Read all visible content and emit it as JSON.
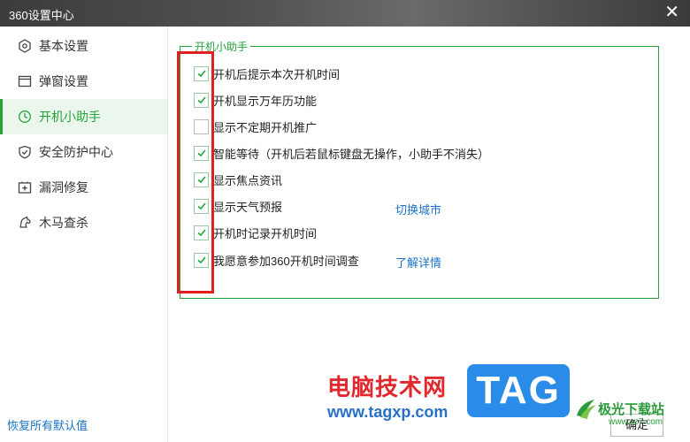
{
  "window": {
    "title": "360设置中心",
    "close_glyph": "✕"
  },
  "sidebar": {
    "items": [
      {
        "label": "基本设置",
        "icon": "hexagon-gear-icon"
      },
      {
        "label": "弹窗设置",
        "icon": "window-icon"
      },
      {
        "label": "开机小助手",
        "icon": "clock-icon",
        "active": true
      },
      {
        "label": "安全防护中心",
        "icon": "shield-icon"
      },
      {
        "label": "漏洞修复",
        "icon": "patch-plus-icon"
      },
      {
        "label": "木马查杀",
        "icon": "horse-icon"
      }
    ],
    "restore_label": "恢复所有默认值"
  },
  "main": {
    "group_title": "开机小助手",
    "options": [
      {
        "label": "开机后提示本次开机时间",
        "checked": true
      },
      {
        "label": "开机显示万年历功能",
        "checked": true
      },
      {
        "label": "显示不定期开机推广",
        "checked": false
      },
      {
        "label": "智能等待（开机后若鼠标键盘无操作，小助手不消失）",
        "checked": true
      },
      {
        "label": "显示焦点资讯",
        "checked": true
      },
      {
        "label": "显示天气预报",
        "checked": true
      },
      {
        "label": "开机时记录开机时间",
        "checked": true
      },
      {
        "label": "我愿意参加360开机时间调查",
        "checked": true
      }
    ],
    "switch_city_label": "切换城市",
    "learn_more_label": "了解详情"
  },
  "footer": {
    "ok_label": "确定"
  },
  "watermark": {
    "cn_text": "电脑技术网",
    "url_text": "www.tagxp.com",
    "tag_text": "TAG",
    "logo_text": "极光下载站",
    "logo_url": "www.xz7.com"
  },
  "colors": {
    "accent": "#23a33a",
    "link": "#1a73c9",
    "highlight": "#e02020"
  }
}
